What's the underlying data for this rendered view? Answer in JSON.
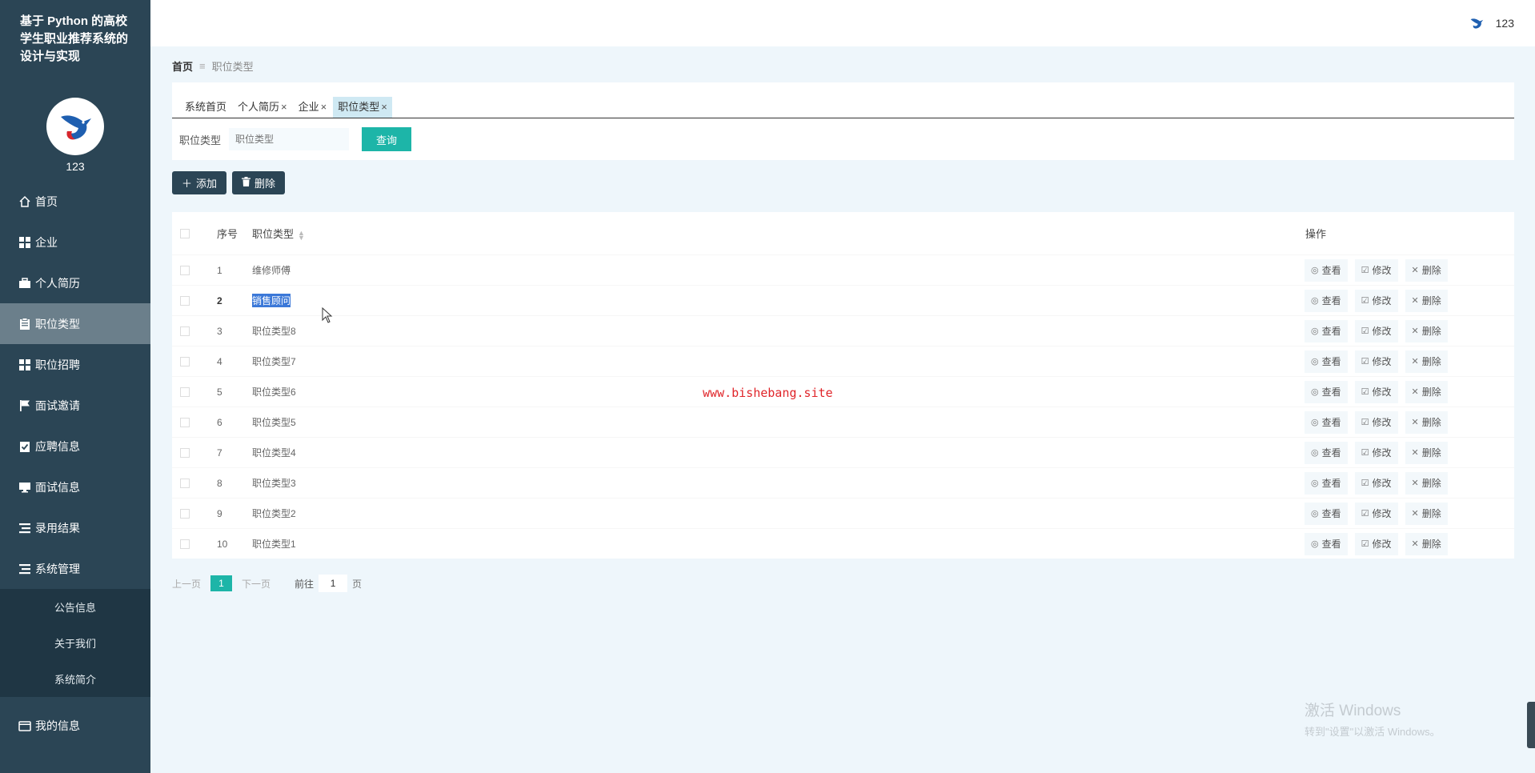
{
  "sidebar": {
    "title": "基于 Python 的高校学生职业推荐系统的设计与实现",
    "username": "123",
    "items": [
      {
        "label": "首页",
        "icon": "home-icon"
      },
      {
        "label": "企业",
        "icon": "grid-icon"
      },
      {
        "label": "个人简历",
        "icon": "briefcase-icon"
      },
      {
        "label": "职位类型",
        "icon": "clipboard-icon"
      },
      {
        "label": "职位招聘",
        "icon": "grid-icon"
      },
      {
        "label": "面试邀请",
        "icon": "flag-icon"
      },
      {
        "label": "应聘信息",
        "icon": "clipboard-check-icon"
      },
      {
        "label": "面试信息",
        "icon": "monitor-icon"
      },
      {
        "label": "录用结果",
        "icon": "list-icon"
      },
      {
        "label": "系统管理",
        "icon": "list-icon"
      }
    ],
    "submenu": [
      "公告信息",
      "关于我们",
      "系统简介"
    ],
    "last_item": {
      "label": "我的信息",
      "icon": "wallet-icon"
    }
  },
  "topbar": {
    "username": "123"
  },
  "breadcrumb": {
    "home": "首页",
    "current": "职位类型"
  },
  "tabs": [
    {
      "label": "系统首页",
      "closable": false
    },
    {
      "label": "个人简历",
      "closable": true
    },
    {
      "label": "企业",
      "closable": true
    },
    {
      "label": "职位类型",
      "closable": true,
      "active": true
    }
  ],
  "search": {
    "label": "职位类型",
    "placeholder": "职位类型",
    "button": "查询"
  },
  "actions": {
    "add": "添加",
    "delete": "删除"
  },
  "table": {
    "headers": {
      "index": "序号",
      "type": "职位类型",
      "ops": "操作"
    },
    "rows": [
      {
        "index": "1",
        "type": "维修师傅"
      },
      {
        "index": "2",
        "type": "销售顾问"
      },
      {
        "index": "3",
        "type": "职位类型8"
      },
      {
        "index": "4",
        "type": "职位类型7"
      },
      {
        "index": "5",
        "type": "职位类型6"
      },
      {
        "index": "6",
        "type": "职位类型5"
      },
      {
        "index": "7",
        "type": "职位类型4"
      },
      {
        "index": "8",
        "type": "职位类型3"
      },
      {
        "index": "9",
        "type": "职位类型2"
      },
      {
        "index": "10",
        "type": "职位类型1"
      }
    ],
    "row_actions": {
      "view": "查看",
      "edit": "修改",
      "delete": "删除"
    }
  },
  "pager": {
    "prev": "上一页",
    "current": "1",
    "next": "下一页",
    "goto": "前往",
    "goto_value": "1",
    "page_unit": "页"
  },
  "watermark": "www.bishebang.site",
  "windows_activation": {
    "line1": "激活 Windows",
    "line2": "转到\"设置\"以激活 Windows。"
  },
  "colors": {
    "sidebar": "#2b4555",
    "accent": "#1db5a8",
    "background": "#eef6fb"
  }
}
